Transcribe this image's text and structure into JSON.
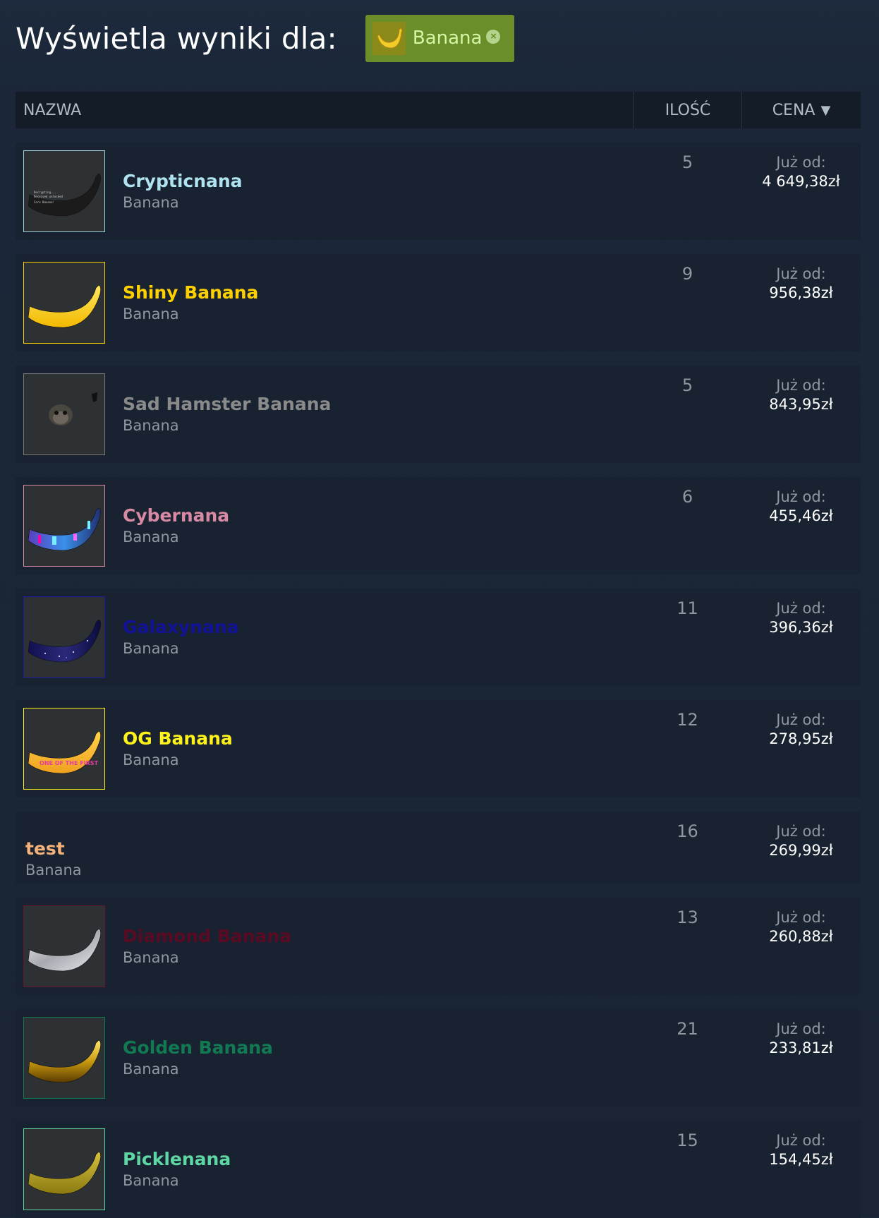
{
  "header": {
    "title": "Wyświetla wyniki dla:",
    "filter_tag": {
      "label": "Banana",
      "remove_icon": "close-circle-icon"
    }
  },
  "table": {
    "columns": {
      "name": "NAZWA",
      "quantity": "ILOŚĆ",
      "price": "CENA",
      "sort_indicator": "▼"
    },
    "price_prefix": "Już od:",
    "rows": [
      {
        "name": "Crypticnana",
        "type": "Banana",
        "quantity": "5",
        "price": "4 649,38zł",
        "name_color": "#b0e3f0",
        "border_color": "#9fd2dc",
        "image": "black-banana"
      },
      {
        "name": "Shiny Banana",
        "type": "Banana",
        "quantity": "9",
        "price": "956,38zł",
        "name_color": "#ffd000",
        "border_color": "#ffd000",
        "image": "yellow-banana"
      },
      {
        "name": "Sad Hamster Banana",
        "type": "Banana",
        "quantity": "5",
        "price": "843,95zł",
        "name_color": "#8a8a8a",
        "border_color": "#777777",
        "image": "hamster"
      },
      {
        "name": "Cybernana",
        "type": "Banana",
        "quantity": "6",
        "price": "455,46zł",
        "name_color": "#d88aa5",
        "border_color": "#d88aa5",
        "image": "cyber-banana"
      },
      {
        "name": "Galaxynana",
        "type": "Banana",
        "quantity": "11",
        "price": "396,36zł",
        "name_color": "#12129a",
        "border_color": "#1a1a9a",
        "image": "galaxy-banana"
      },
      {
        "name": "OG Banana",
        "type": "Banana",
        "quantity": "12",
        "price": "278,95zł",
        "name_color": "#fff21a",
        "border_color": "#fff21a",
        "image": "og-banana"
      },
      {
        "name": "test",
        "type": "Banana",
        "quantity": "16",
        "price": "269,99zł",
        "name_color": "#f5b27a",
        "border_color": "",
        "image": ""
      },
      {
        "name": "Diamond Banana",
        "type": "Banana",
        "quantity": "13",
        "price": "260,88zł",
        "name_color": "#5a0a22",
        "border_color": "#6a1530",
        "image": "diamond-banana"
      },
      {
        "name": "Golden Banana",
        "type": "Banana",
        "quantity": "21",
        "price": "233,81zł",
        "name_color": "#127a52",
        "border_color": "#127a52",
        "image": "golden-banana"
      },
      {
        "name": "Picklenana",
        "type": "Banana",
        "quantity": "15",
        "price": "154,45zł",
        "name_color": "#5fd7a5",
        "border_color": "#5fd7a5",
        "image": "pickle-banana"
      }
    ]
  }
}
